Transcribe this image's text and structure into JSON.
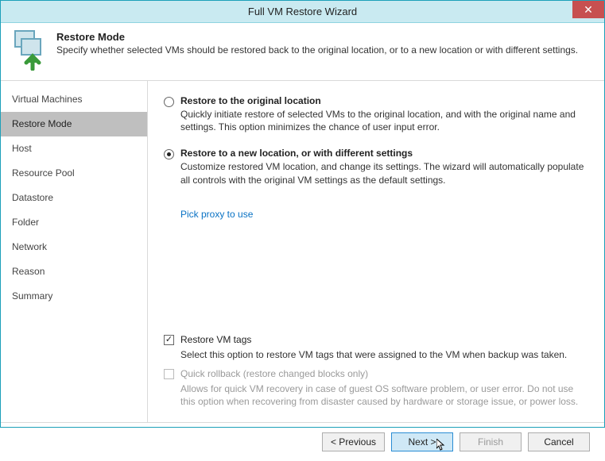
{
  "window": {
    "title": "Full VM Restore Wizard"
  },
  "header": {
    "title": "Restore Mode",
    "subtitle": "Specify whether selected VMs should be restored back to the original location, or to a new location or with different settings."
  },
  "sidebar": {
    "items": [
      {
        "label": "Virtual Machines",
        "active": false
      },
      {
        "label": "Restore Mode",
        "active": true
      },
      {
        "label": "Host",
        "active": false
      },
      {
        "label": "Resource Pool",
        "active": false
      },
      {
        "label": "Datastore",
        "active": false
      },
      {
        "label": "Folder",
        "active": false
      },
      {
        "label": "Network",
        "active": false
      },
      {
        "label": "Reason",
        "active": false
      },
      {
        "label": "Summary",
        "active": false
      }
    ]
  },
  "options": {
    "original": {
      "title": "Restore to the original location",
      "desc": "Quickly initiate restore of selected VMs to the original location, and with the original name and settings. This option minimizes the chance of user input error.",
      "selected": false
    },
    "newloc": {
      "title": "Restore to a new location, or with different settings",
      "desc": "Customize restored VM location, and change its settings. The wizard will automatically populate all controls with the original VM settings as the default settings.",
      "selected": true
    },
    "proxy_link": "Pick proxy to use"
  },
  "checkboxes": {
    "tags": {
      "label": "Restore VM tags",
      "desc": "Select this option to restore VM tags that were assigned to the VM when backup was taken.",
      "checked": true,
      "enabled": true
    },
    "quick": {
      "label": "Quick rollback (restore changed blocks only)",
      "desc": "Allows for quick VM recovery in case of guest OS software problem, or user error. Do not use this option when recovering from disaster caused by hardware or storage issue, or power loss.",
      "checked": false,
      "enabled": false
    }
  },
  "buttons": {
    "previous": "< Previous",
    "next": "Next >",
    "finish": "Finish",
    "cancel": "Cancel"
  }
}
